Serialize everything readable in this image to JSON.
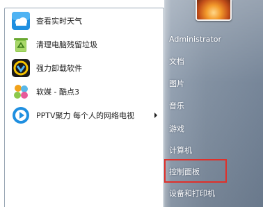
{
  "programs": [
    {
      "label": "查看实时天气",
      "icon": "weather-icon",
      "has_submenu": false
    },
    {
      "label": "清理电脑残留垃圾",
      "icon": "recycle-bin-icon",
      "has_submenu": false
    },
    {
      "label": "强力卸载软件",
      "icon": "uninstall-icon",
      "has_submenu": false
    },
    {
      "label": "软媒 - 酷点3",
      "icon": "kudian-icon",
      "has_submenu": false
    },
    {
      "label": "PPTV聚力 每个人的网络电视",
      "icon": "pptv-icon",
      "has_submenu": true
    }
  ],
  "user": {
    "name": "Administrator"
  },
  "places": [
    {
      "label": "文档",
      "key": "documents"
    },
    {
      "label": "图片",
      "key": "pictures"
    },
    {
      "label": "音乐",
      "key": "music"
    },
    {
      "label": "游戏",
      "key": "games"
    },
    {
      "label": "计算机",
      "key": "computer"
    },
    {
      "label": "控制面板",
      "key": "control-panel"
    },
    {
      "label": "设备和打印机",
      "key": "devices-printers"
    }
  ],
  "highlight": {
    "target": "control-panel",
    "color": "#e0302a"
  }
}
